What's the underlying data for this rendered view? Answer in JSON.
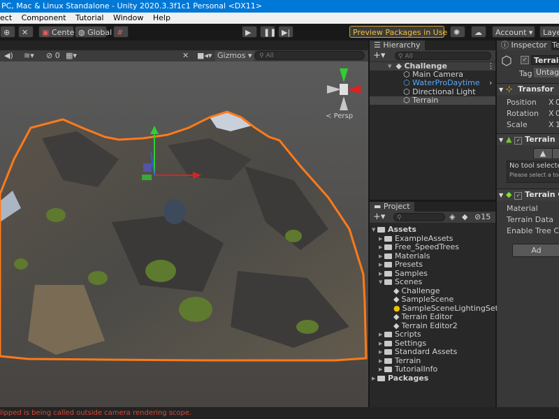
{
  "window": {
    "title": "PC, Mac & Linux Standalone - Unity 2020.3.3f1c1 Personal <DX11>"
  },
  "menu": {
    "items": [
      "ect",
      "Component",
      "Tutorial",
      "Window",
      "Help"
    ]
  },
  "toolbar": {
    "pivot_label": "Center",
    "space_label": "Global",
    "preview_label": "Preview Packages in Use",
    "account_label": "Account",
    "layers_label": "Laye"
  },
  "scene": {
    "hidden_count": "0",
    "gizmos_label": "Gizmos",
    "search_placeholder": "All",
    "persp_label": "Persp",
    "gizmo_axis_x": "x",
    "terrain_edge_color": "#ff7a1a",
    "axis_y_color": "#2fd02f",
    "axis_x_color": "#e02020",
    "axis_z_color": "#2f5fe0"
  },
  "hierarchy": {
    "tab_label": "Hierarchy",
    "search_placeholder": "All",
    "scene_name": "Challenge",
    "items": [
      {
        "label": "Main Camera",
        "color": "#d2d2d2"
      },
      {
        "label": "WaterProDaytime",
        "color": "#5aa8ff"
      },
      {
        "label": "Directional Light",
        "color": "#d2d2d2"
      },
      {
        "label": "Terrain",
        "color": "#d2d2d2"
      }
    ]
  },
  "project": {
    "tab_label": "Project",
    "hidden_count": "15",
    "root_label": "Assets",
    "folders_before": [
      "ExampleAssets",
      "Free_SpeedTrees",
      "Materials",
      "Presets",
      "Samples"
    ],
    "scenes_label": "Scenes",
    "scene_files": [
      "Challenge",
      "SampleScene",
      "SampleSceneLightingSettings",
      "Terrain Editor",
      "Terrain Editor2"
    ],
    "folders_after": [
      "Scripts",
      "Settings",
      "Standard Assets",
      "Terrain",
      "TutorialInfo"
    ],
    "packages_label": "Packages"
  },
  "inspector": {
    "tab_label": "Inspector",
    "tab2_label": "Te",
    "object_name": "Terrain",
    "tag_label": "Tag",
    "tag_value": "Untagg",
    "transform_label": "Transfor",
    "position_label": "Position",
    "rotation_label": "Rotation",
    "scale_label": "Scale",
    "axis_x_label": "X",
    "position_x": "0",
    "rotation_x": "0",
    "scale_x": "1",
    "terrain_component_label": "Terrain",
    "no_tool_text": "No tool selected",
    "please_select_text": "Please select a tool",
    "collider_label": "Terrain C",
    "material_label": "Material",
    "terrain_data_label": "Terrain Data",
    "enable_tree_label": "Enable Tree Colli",
    "add_component_label": "Ad"
  },
  "console": {
    "message": "lipped is being called outside camera rendering scope."
  }
}
